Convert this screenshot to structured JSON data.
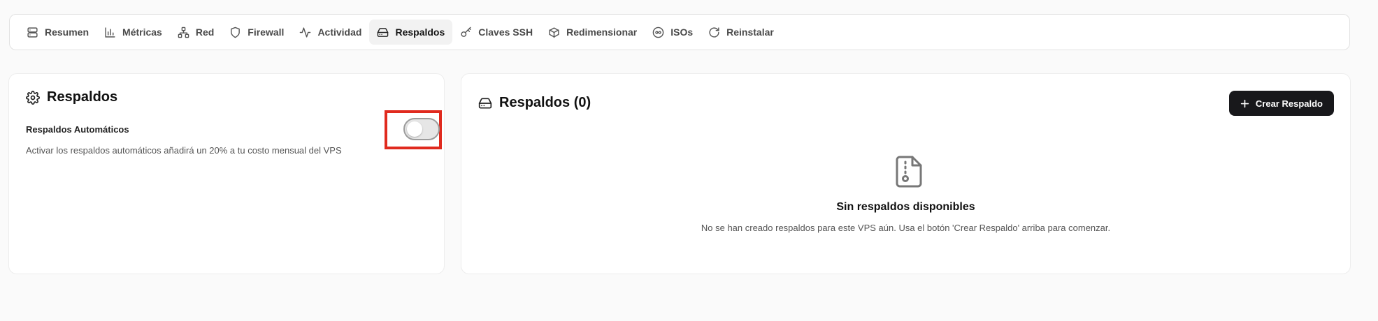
{
  "tabs": [
    {
      "label": "Resumen",
      "icon": "server-icon"
    },
    {
      "label": "Métricas",
      "icon": "bar-chart-icon"
    },
    {
      "label": "Red",
      "icon": "network-icon"
    },
    {
      "label": "Firewall",
      "icon": "shield-icon"
    },
    {
      "label": "Actividad",
      "icon": "activity-icon"
    },
    {
      "label": "Respaldos",
      "icon": "hard-drive-icon",
      "active": true
    },
    {
      "label": "Claves SSH",
      "icon": "key-icon"
    },
    {
      "label": "Redimensionar",
      "icon": "package-icon"
    },
    {
      "label": "ISOs",
      "icon": "disc-icon"
    },
    {
      "label": "Reinstalar",
      "icon": "refresh-icon"
    }
  ],
  "settings": {
    "title": "Respaldos",
    "auto_label": "Respaldos Automáticos",
    "auto_desc": "Activar los respaldos automáticos añadirá un 20% a tu costo mensual del VPS",
    "auto_enabled": false
  },
  "backups": {
    "title": "Respaldos (0)",
    "create_label": "Crear Respaldo",
    "empty_title": "Sin respaldos disponibles",
    "empty_desc": "No se han creado respaldos para este VPS aún. Usa el botón 'Crear Respaldo' arriba para comenzar."
  },
  "colors": {
    "accent_dark": "#18181b",
    "highlight": "#e02a1e"
  }
}
